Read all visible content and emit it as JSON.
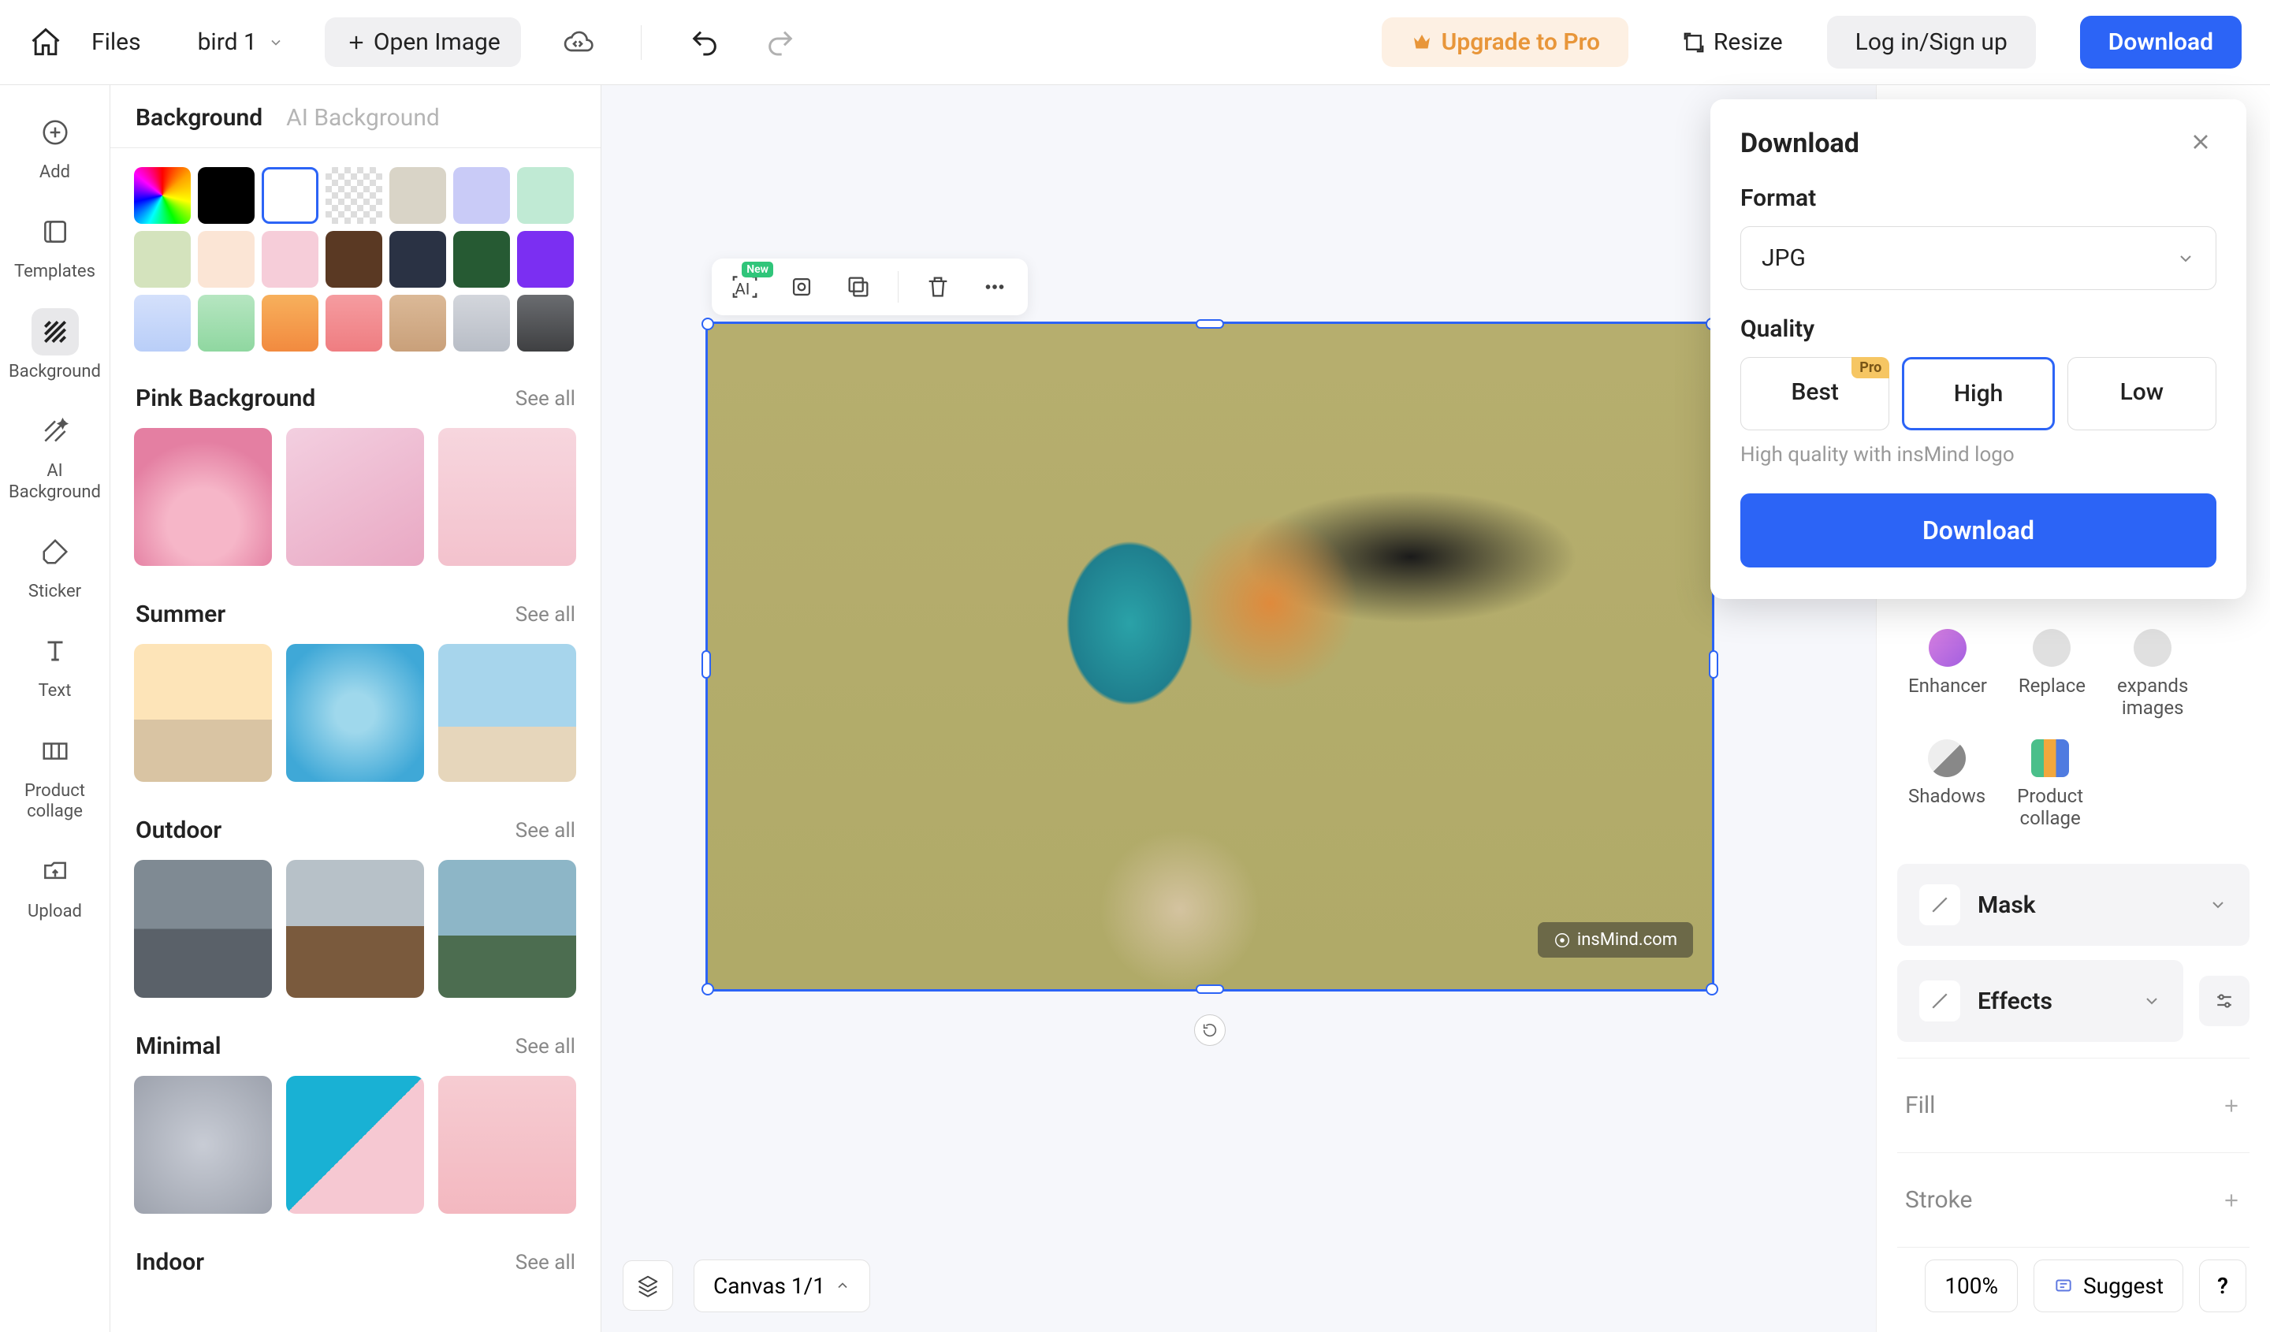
{
  "topbar": {
    "files": "Files",
    "fname": "bird 1",
    "open_image": "Open Image",
    "upgrade": "Upgrade to Pro",
    "resize": "Resize",
    "login": "Log in/Sign up",
    "download": "Download"
  },
  "left_rail": [
    {
      "label": "Add"
    },
    {
      "label": "Templates"
    },
    {
      "label": "Background"
    },
    {
      "label": "AI\nBackground"
    },
    {
      "label": "Sticker"
    },
    {
      "label": "Text"
    },
    {
      "label": "Product\ncollage"
    },
    {
      "label": "Upload"
    }
  ],
  "bg_panel": {
    "tab1": "Background",
    "tab2": "AI Background",
    "see_all": "See all",
    "categories": [
      "Pink Background",
      "Summer",
      "Outdoor",
      "Minimal",
      "Indoor"
    ]
  },
  "canvas": {
    "watermark": "insMind.com",
    "float_new_badge": "New"
  },
  "right_panel": {
    "tools_row1": [
      "Enhancer",
      "Replace",
      "expands\nimages"
    ],
    "tools_row2": [
      "Shadows",
      "Product\ncollage"
    ],
    "mask": "Mask",
    "effects": "Effects",
    "fill": "Fill",
    "stroke": "Stroke"
  },
  "download_modal": {
    "title": "Download",
    "format_label": "Format",
    "format_value": "JPG",
    "quality_label": "Quality",
    "q_best": "Best",
    "q_pro_tag": "Pro",
    "q_high": "High",
    "q_low": "Low",
    "note": "High quality with insMind logo",
    "action": "Download"
  },
  "bottom": {
    "canvas": "Canvas 1/1",
    "zoom": "100%",
    "suggest": "Suggest",
    "help": "?"
  }
}
